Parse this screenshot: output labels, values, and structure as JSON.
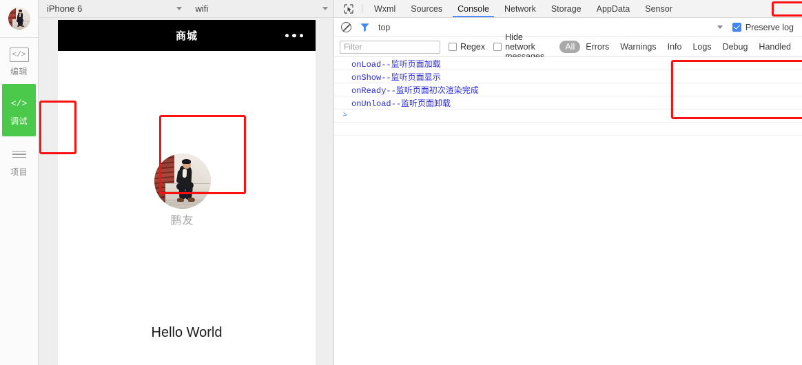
{
  "rail": {
    "avatar_name": "user-avatar-thumbnail",
    "items": [
      {
        "icon": "code-icon",
        "glyph": "</>",
        "label": "编辑",
        "active": false
      },
      {
        "icon": "code-icon",
        "glyph": "</>",
        "label": "调试",
        "active": true
      },
      {
        "icon": "hamburger-icon",
        "glyph": "",
        "label": "项目",
        "active": false
      }
    ]
  },
  "simulator": {
    "device_select": {
      "value": "iPhone 6"
    },
    "network_select": {
      "value": "wifi"
    },
    "phone": {
      "title": "商城",
      "more_menu": "more-dots-icon",
      "photo_caption": "鹏友",
      "hello_text": "Hello World"
    }
  },
  "devtools": {
    "inspect_icon": "inspect-element-icon",
    "tabs": [
      {
        "label": "Wxml",
        "selected": false
      },
      {
        "label": "Sources",
        "selected": false
      },
      {
        "label": "Console",
        "selected": true
      },
      {
        "label": "Network",
        "selected": false
      },
      {
        "label": "Storage",
        "selected": false
      },
      {
        "label": "AppData",
        "selected": false
      },
      {
        "label": "Sensor",
        "selected": false
      }
    ],
    "controls": {
      "clear_icon": "clear-console-icon",
      "filter_icon": "filter-funnel-icon",
      "context": "top",
      "context_caret": "chevron-down-icon",
      "preserve_log_label": "Preserve log",
      "preserve_log_checked": true
    },
    "filterbar": {
      "filter_placeholder": "Filter",
      "filter_value": "",
      "regex_label": "Regex",
      "regex_checked": false,
      "hide_network_label": "Hide network messages",
      "hide_network_checked": false,
      "levels": [
        {
          "label": "All",
          "on": true
        },
        {
          "label": "Errors",
          "on": false
        },
        {
          "label": "Warnings",
          "on": false
        },
        {
          "label": "Info",
          "on": false
        },
        {
          "label": "Logs",
          "on": false
        },
        {
          "label": "Debug",
          "on": false
        },
        {
          "label": "Handled",
          "on": false
        }
      ]
    },
    "console_logs": [
      "onLoad--监听页面加载",
      "onShow--监听页面显示",
      "onReady--监听页面初次渲染完成",
      "onUnload--监听页面卸载"
    ],
    "prompt_caret": ">"
  },
  "annotations": {
    "color": "#fb1111",
    "boxes": [
      "rail-debug-button",
      "phone-photo-card",
      "console-tab",
      "level-all-button",
      "level-debug-button",
      "console-log-output"
    ]
  },
  "colors": {
    "accent_green": "#4ac94a",
    "annotation_red": "#fb1111",
    "log_blue": "#2b2bd6",
    "tab_underline_blue": "#4c8ef7",
    "checkbox_blue": "#4285f4",
    "phone_navbar": "#000000"
  }
}
